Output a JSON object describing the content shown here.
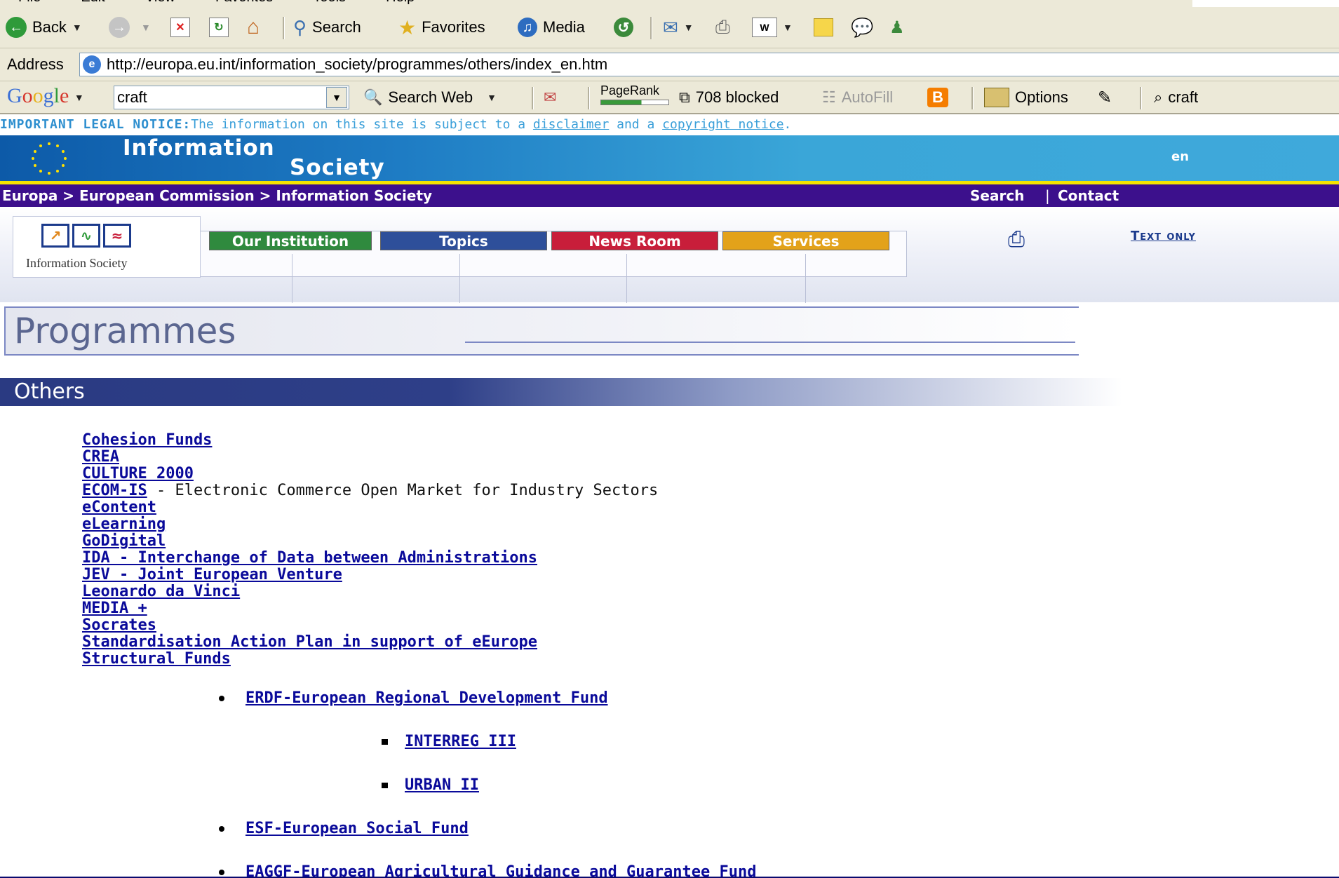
{
  "browser": {
    "menu": [
      "File",
      "Edit",
      "View",
      "Favorites",
      "Tools",
      "Help"
    ],
    "toolbar": {
      "back_label": "Back",
      "search_label": "Search",
      "favorites_label": "Favorites",
      "media_label": "Media"
    },
    "address": {
      "label": "Address",
      "url": "http://europa.eu.int/information_society/programmes/others/index_en.htm"
    },
    "google_bar": {
      "logo": "Google",
      "query": "craft",
      "search_web_label": "Search Web",
      "pagerank_label": "PageRank",
      "blocked_label": "708 blocked",
      "autofill_label": "AutoFill",
      "options_label": "Options",
      "highlight_term": "craft"
    }
  },
  "legal_notice": {
    "prefix": "IMPORTANT LEGAL NOTICE:",
    "text1": "The information on this site is subject to a ",
    "disclaimer": "disclaimer",
    "text2": " and a ",
    "copyright": "copyright notice",
    "text3": "."
  },
  "banner": {
    "title_line1": "Information",
    "title_line2": "Society",
    "language": "en"
  },
  "breadcrumb": {
    "path": "Europa > European Commission > Information Society",
    "search": "Search",
    "separator": "|",
    "contact": "Contact"
  },
  "nav": {
    "logo_text": "Information Society",
    "tabs": [
      {
        "label": "Our Institution",
        "color": "#2f8a3e"
      },
      {
        "label": "Topics",
        "color": "#2e4f9a"
      },
      {
        "label": "News Room",
        "color": "#c81e3a"
      },
      {
        "label": "Services",
        "color": "#e3a21a"
      }
    ],
    "text_only": "Text only"
  },
  "page_title": "Programmes",
  "section_title": "Others",
  "programmes": [
    {
      "label": "Cohesion Funds"
    },
    {
      "label": "CREA"
    },
    {
      "label": "CULTURE 2000"
    },
    {
      "label": "ECOM-IS",
      "description": " - Electronic Commerce Open Market for Industry Sectors"
    },
    {
      "label": "eContent"
    },
    {
      "label": "eLearning"
    },
    {
      "label": "GoDigital"
    },
    {
      "label": "IDA - Interchange of Data between Administrations"
    },
    {
      "label": "JEV - Joint European Venture"
    },
    {
      "label": "Leonardo da Vinci"
    },
    {
      "label": "MEDIA +"
    },
    {
      "label": "Socrates"
    },
    {
      "label": "Standardisation Action Plan in support of eEurope"
    },
    {
      "label": "Structural Funds"
    }
  ],
  "structural_funds": {
    "erdf": "ERDF-European Regional Development Fund",
    "interreg": "INTERREG III",
    "urban": "URBAN II",
    "esf": "ESF-European Social Fund",
    "eaggf": "EAGGF-European Agricultural Guidance and Guarantee Fund"
  }
}
